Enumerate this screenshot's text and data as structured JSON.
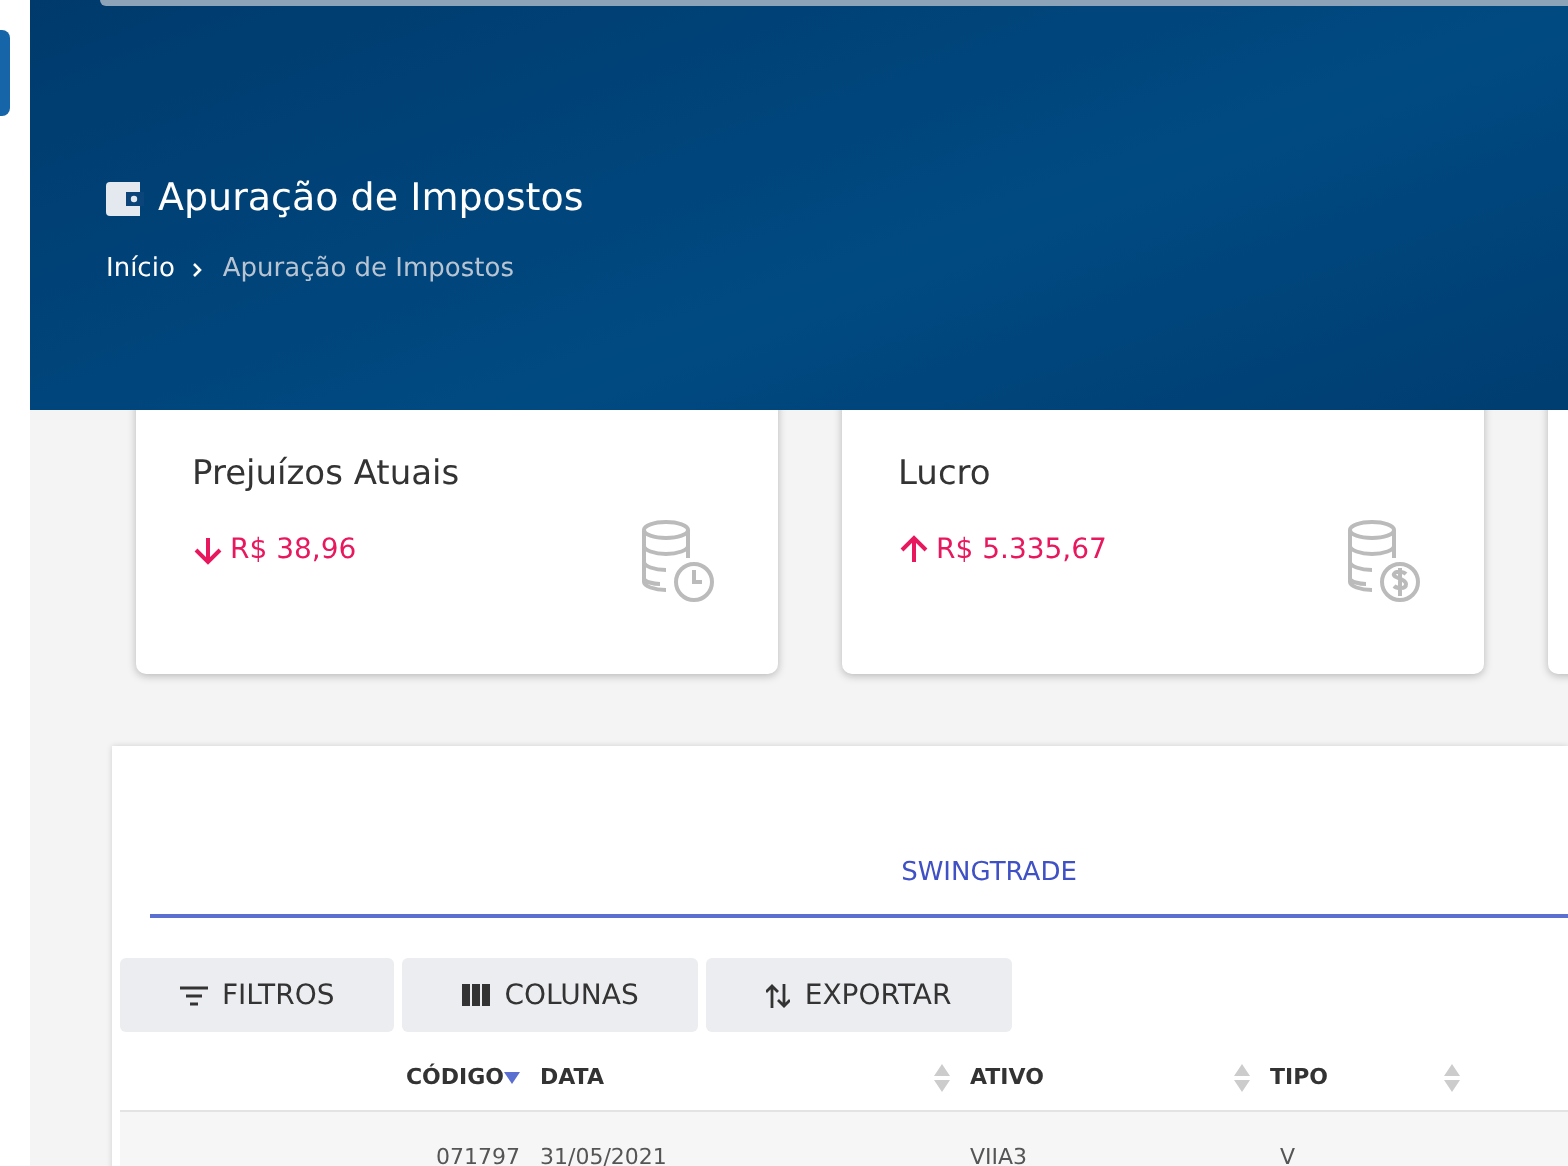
{
  "header": {
    "title": "Apuração de Impostos",
    "breadcrumb": [
      {
        "label": "Início",
        "current": false
      },
      {
        "label": "Apuração de Impostos",
        "current": true
      }
    ]
  },
  "cards": [
    {
      "title": "Prejuízos Atuais",
      "rising": false,
      "value": "R$ 38,96",
      "kind": "loss"
    },
    {
      "title": "Lucro",
      "rising": true,
      "value": "R$ 5.335,67",
      "kind": "profit"
    },
    {
      "kind": "empty"
    }
  ],
  "tabs": [
    {
      "label": "SWINGTRADE",
      "selected": true
    }
  ],
  "toolbar": [
    {
      "label": "FILTROS",
      "kind": "filter"
    },
    {
      "label": "COLUNAS",
      "kind": "columns"
    },
    {
      "label": "EXPORTAR",
      "kind": "export"
    }
  ],
  "table": {
    "columns": [
      {
        "label": "CÓDIGO",
        "sorted": true
      },
      {
        "label": "DATA",
        "sorted": false
      },
      {
        "label": "ATIVO",
        "sorted": false
      },
      {
        "label": "TIPO",
        "sorted": false
      }
    ],
    "rows": [
      [
        "071797",
        "31/05/2021",
        "VIIA3",
        "V"
      ]
    ]
  }
}
